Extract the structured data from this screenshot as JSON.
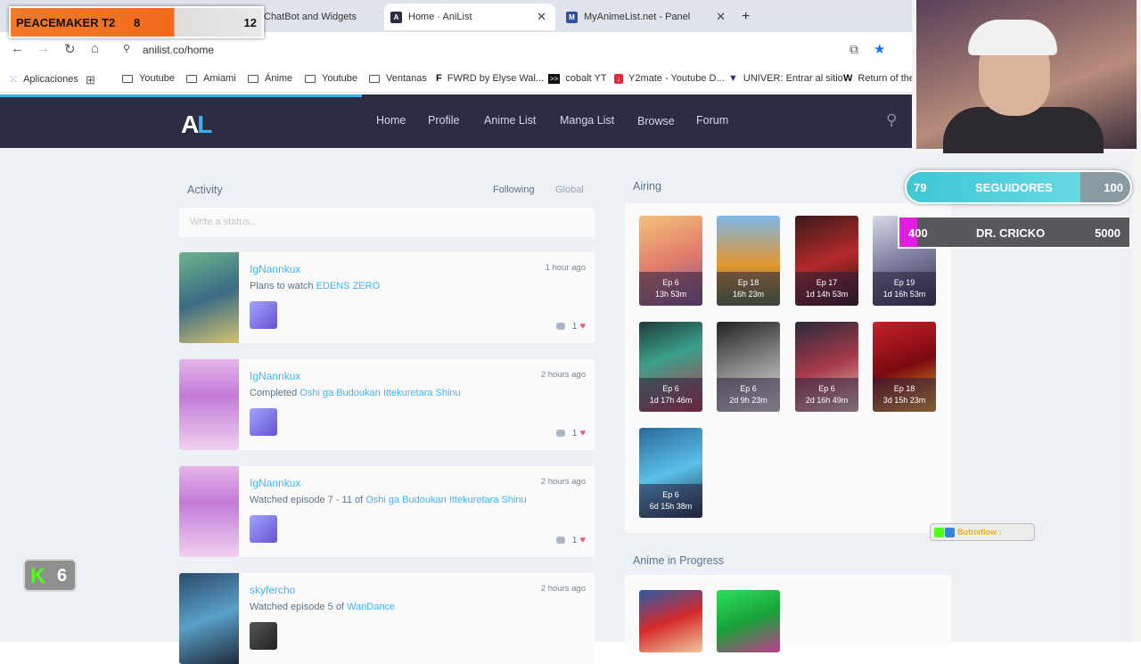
{
  "browser": {
    "tabs": [
      {
        "label": "ChatBot and Widgets",
        "active": false
      },
      {
        "label": "Home · AniList",
        "active": true
      },
      {
        "label": "MyAnimeList.net - Panel",
        "active": false
      }
    ],
    "url": "anilist.co/home",
    "bookmarks": [
      {
        "label": "Aplicaciones",
        "icon": "apps-icon"
      },
      {
        "label": "Youtube",
        "icon": "folder-icon"
      },
      {
        "label": "Amiami",
        "icon": "folder-icon"
      },
      {
        "label": "Ánime",
        "icon": "folder-icon"
      },
      {
        "label": "Youtube",
        "icon": "folder-icon"
      },
      {
        "label": "Ventanas",
        "icon": "folder-icon"
      },
      {
        "label": "FWRD by Elyse Wal...",
        "icon": "fwrd-icon"
      },
      {
        "label": "cobalt YT",
        "icon": "cobalt-icon"
      },
      {
        "label": "Y2mate - Youtube D...",
        "icon": "y2mate-icon"
      },
      {
        "label": "UNIVER: Entrar al sitio",
        "icon": "univer-icon"
      },
      {
        "label": "Return of the",
        "icon": "w-icon"
      }
    ]
  },
  "site": {
    "logo": "AL",
    "nav": [
      "Home",
      "Profile",
      "Anime List",
      "Manga List",
      "Browse",
      "Forum"
    ],
    "accent": "#3db4f2",
    "nav_bg": "#2b2d42"
  },
  "activity": {
    "title": "Activity",
    "filters": [
      "Following",
      "Global"
    ],
    "status_placeholder": "Write a status...",
    "items": [
      {
        "user": "IgNannkux",
        "time": "1 hour ago",
        "verb": "Plans to watch",
        "media": "EDENS ZERO",
        "likes": "1"
      },
      {
        "user": "IgNannkux",
        "time": "2 hours ago",
        "verb": "Completed",
        "media": "Oshi ga Budoukan Ittekuretara Shinu",
        "likes": "1"
      },
      {
        "user": "IgNannkux",
        "time": "2 hours ago",
        "verb": "Watched episode 7 - 11 of",
        "media": "Oshi ga Budoukan Ittekuretara Shinu",
        "likes": "1"
      },
      {
        "user": "skyfercho",
        "time": "2 hours ago",
        "verb": "Watched episode 5 of",
        "media": "WanDance",
        "likes": ""
      }
    ]
  },
  "airing": {
    "title": "Airing",
    "items": [
      {
        "ep": "Ep 6",
        "time": "13h 53m"
      },
      {
        "ep": "Ep 18",
        "time": "16h 23m"
      },
      {
        "ep": "Ep 17",
        "time": "1d 14h 53m"
      },
      {
        "ep": "Ep 19",
        "time": "1d 16h 53m"
      },
      {
        "ep": "Ep 6",
        "time": "1d 17h 46m"
      },
      {
        "ep": "Ep 6",
        "time": "2d 9h 23m"
      },
      {
        "ep": "Ep 6",
        "time": "2d 16h 49m"
      },
      {
        "ep": "Ep 18",
        "time": "3d 15h 23m"
      },
      {
        "ep": "Ep 6",
        "time": "6d 15h 38m"
      }
    ]
  },
  "in_progress": {
    "title": "Anime in Progress"
  },
  "overlays": {
    "peacemaker": {
      "title": "PEACEMAKER T2",
      "score_a": "8",
      "score_b": "12"
    },
    "followers": {
      "current": "79",
      "label": "SEGUIDORES",
      "goal": "100"
    },
    "sub_goal": {
      "current": "400",
      "label": "DR. CRICKO",
      "goal": "5000"
    },
    "kick": {
      "letter": "K",
      "count": "6"
    },
    "botrix": {
      "label": "Botrixflow :"
    }
  }
}
